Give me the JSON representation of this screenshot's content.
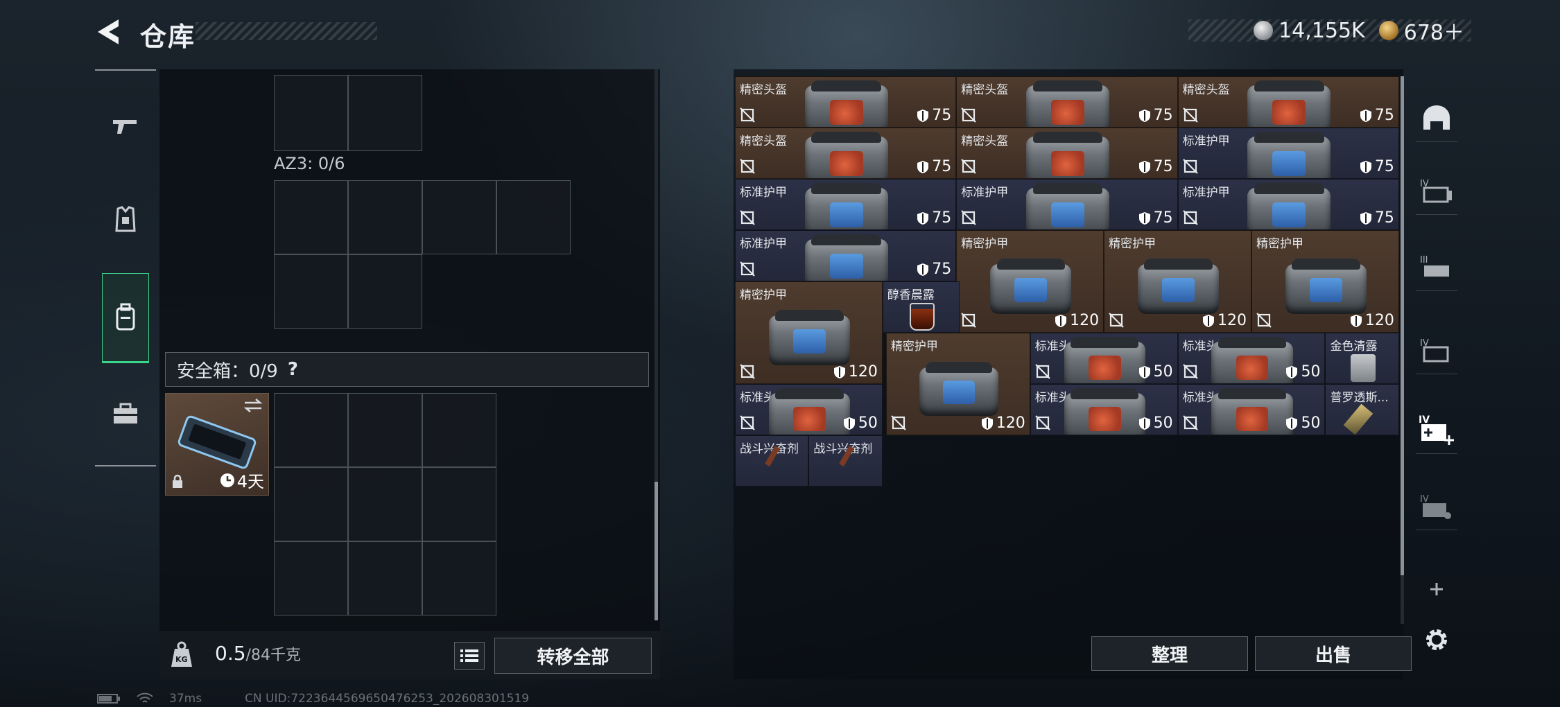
{
  "header": {
    "title": "仓库",
    "currency": [
      {
        "icon": "silver-coin-icon",
        "value": "14,155K"
      },
      {
        "icon": "gold-coin-icon",
        "value": "678＋"
      }
    ]
  },
  "left_tabs": [
    {
      "icon": "pistol-icon",
      "active": false
    },
    {
      "icon": "armor-vest-icon",
      "active": false
    },
    {
      "icon": "backpack-icon",
      "active": true
    },
    {
      "icon": "toolbox-icon",
      "active": false
    }
  ],
  "left": {
    "az3_label": "AZ3: 0/6",
    "safe_label": "安全箱：0/9",
    "help": "?",
    "safe_timer": "4天",
    "weight_value": "0.5",
    "weight_max": "/84千克",
    "weight_icon": "KG",
    "transfer_all": "转移全部"
  },
  "inventory": {
    "items": [
      {
        "name": "精密头盔",
        "value": "75",
        "bg": "brown",
        "patch": "red"
      },
      {
        "name": "精密头盔",
        "value": "75",
        "bg": "brown",
        "patch": "red"
      },
      {
        "name": "精密头盔",
        "value": "75",
        "bg": "brown",
        "patch": "red"
      },
      {
        "name": "精密头盔",
        "value": "75",
        "bg": "brown",
        "patch": "red"
      },
      {
        "name": "精密头盔",
        "value": "75",
        "bg": "brown",
        "patch": "red"
      },
      {
        "name": "标准护甲",
        "value": "75",
        "bg": "blue",
        "patch": "blue"
      },
      {
        "name": "标准护甲",
        "value": "75",
        "bg": "blue",
        "patch": "blue"
      },
      {
        "name": "标准护甲",
        "value": "75",
        "bg": "blue",
        "patch": "blue"
      },
      {
        "name": "标准护甲",
        "value": "75",
        "bg": "blue",
        "patch": "blue"
      },
      {
        "name": "标准护甲",
        "value": "75",
        "bg": "blue",
        "patch": "blue"
      },
      {
        "name": "精密护甲",
        "value": "120",
        "bg": "brown",
        "patch": "blue"
      },
      {
        "name": "精密护甲",
        "value": "120",
        "bg": "brown",
        "patch": "blue"
      },
      {
        "name": "精密护甲",
        "value": "120",
        "bg": "brown",
        "patch": "blue"
      },
      {
        "name": "精密护甲",
        "value": "120",
        "bg": "brown",
        "patch": "blue"
      },
      {
        "name": "醇香晨露",
        "value": "",
        "bg": "blue",
        "patch": "drink"
      },
      {
        "name": "精密护甲",
        "value": "120",
        "bg": "brown",
        "patch": "blue"
      },
      {
        "name": "标准头盔",
        "value": "50",
        "bg": "blue",
        "patch": "red"
      },
      {
        "name": "标准头盔",
        "value": "50",
        "bg": "blue",
        "patch": "red"
      },
      {
        "name": "金色清露",
        "value": "",
        "bg": "blue",
        "patch": "glass"
      },
      {
        "name": "标准头盔",
        "value": "50",
        "bg": "blue",
        "patch": "red"
      },
      {
        "name": "标准头盔",
        "value": "50",
        "bg": "blue",
        "patch": "red"
      },
      {
        "name": "标准头盔",
        "value": "50",
        "bg": "blue",
        "patch": "red"
      },
      {
        "name": "普罗透斯...",
        "value": "",
        "bg": "blue",
        "patch": "syringe"
      },
      {
        "name": "战斗兴奋剂",
        "value": "",
        "bg": "blue",
        "patch": "stim"
      },
      {
        "name": "战斗兴奋剂",
        "value": "",
        "bg": "blue",
        "patch": "stim"
      }
    ]
  },
  "actions": {
    "sort": "整理",
    "sell": "出售"
  },
  "right_tabs": [
    {
      "icon": "helmet-icon"
    },
    {
      "icon": "storage-iv-icon"
    },
    {
      "icon": "storage-iii-icon"
    },
    {
      "icon": "storage-iv-b-icon"
    },
    {
      "icon": "storage-iv-add-icon"
    },
    {
      "icon": "storage-iv-c-icon"
    },
    {
      "icon": "plus-icon"
    },
    {
      "icon": "gear-icon"
    }
  ],
  "status": {
    "ping": "37ms",
    "uid": "CN UID:7223644569650476253_202608301519"
  }
}
